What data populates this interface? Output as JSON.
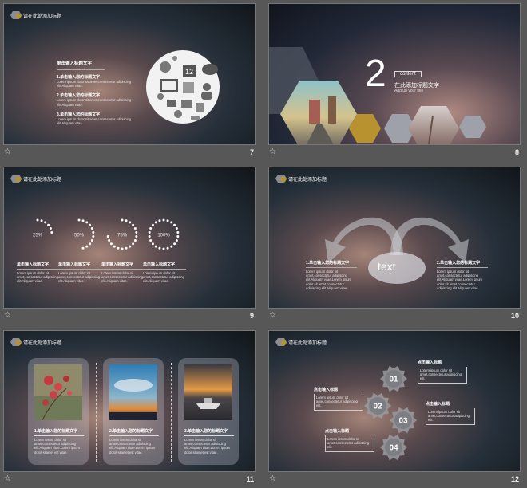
{
  "slides": {
    "s7": {
      "number": "7",
      "header": "请在此处添加标题",
      "title": "单击输入标题文字",
      "items": [
        {
          "heading": "1.单击输入您的标题文字",
          "body": "Lorem ipsum dolor sit amet,consectetur adipiscing elit.Aliquam vitae."
        },
        {
          "heading": "2.单击输入您的标题文字",
          "body": "Lorem ipsum dolor sit amet,consectetur adipiscing elit.Aliquam vitae."
        },
        {
          "heading": "3.单击输入您的标题文字",
          "body": "Lorem ipsum dolor sit amet,consectetur adipiscing elit.Aliquam vitae."
        }
      ],
      "icon_cluster_label": "12"
    },
    "s8": {
      "number": "8",
      "big_number": "2",
      "badge": "content",
      "title": "在此添加标题文字",
      "subtitle": "Add up your title"
    },
    "s9": {
      "number": "9",
      "header": "请在此处添加标题",
      "progress": [
        {
          "label": "25%",
          "value": 0.25,
          "heading": "单击输入标题文字",
          "body": "Lorem ipsum dolor sit amet,consectetur adipiscing elit.Aliquam vitae."
        },
        {
          "label": "50%",
          "value": 0.5,
          "heading": "单击输入标题文字",
          "body": "Lorem ipsum dolor sit amet,consectetur adipiscing elit.Aliquam vitae."
        },
        {
          "label": "75%",
          "value": 0.75,
          "heading": "单击输入标题文字",
          "body": "Lorem ipsum dolor sit amet,consectetur adipiscing elit.Aliquam vitae."
        },
        {
          "label": "100%",
          "value": 1.0,
          "heading": "单击输入标题文字",
          "body": "Lorem ipsum dolor sit amet,consectetur adipiscing elit.Aliquam vitae."
        }
      ]
    },
    "s10": {
      "number": "10",
      "header": "请在此处添加标题",
      "center_text": "text",
      "left": {
        "heading": "1.单击输入您的标题文字",
        "body": "Lorem ipsum dolor sit amet,consectetur adipiscing elit.Aliquam vitae.Lorem ipsum dolor sit amet,consectetur adipiscing elit.Aliquam vitae."
      },
      "right": {
        "heading": "2.单击输入您的标题文字",
        "body": "Lorem ipsum dolor sit amet,consectetur adipiscing elit.Aliquam vitae.Lorem ipsum dolor sit amet,consectetur adipiscing elit.Aliquam vitae."
      }
    },
    "s11": {
      "number": "11",
      "header": "请在此处添加标题",
      "cards": [
        {
          "heading": "1.单击输入您的标题文字",
          "body": "Lorem ipsum dolor sit amet,consectetur adipiscing elit.Aliquam vitae.Lorem ipsum dolor sitamet elit vitae."
        },
        {
          "heading": "2.单击输入您的标题文字",
          "body": "Lorem ipsum dolor sit amet,consectetur adipiscing elit.Aliquam vitae.Lorem ipsum dolor sitamet elit vitae."
        },
        {
          "heading": "3.单击输入您的标题文字",
          "body": "Lorem ipsum dolor sit amet,consectetur adipiscing elit.Aliquam vitae.Lorem ipsum dolor sitamet elit vitae."
        }
      ]
    },
    "s12": {
      "number": "12",
      "header": "请在此处添加标题",
      "gears": [
        "01",
        "02",
        "03",
        "04"
      ],
      "notes": [
        {
          "heading": "点击输入标题",
          "body": "Lorem ipsum dolor sit amet,consectetur adipiscing elit."
        },
        {
          "heading": "点击输入标题",
          "body": "Lorem ipsum dolor sit amet,consectetur adipiscing elit."
        },
        {
          "heading": "点击输入标题",
          "body": "Lorem ipsum dolor sit amet,consectetur adipiscing elit."
        },
        {
          "heading": "点击输入标题",
          "body": "Lorem ipsum dolor sit amet,consectetur adipiscing elit."
        }
      ]
    }
  },
  "icons": {
    "star": "☆"
  },
  "colors": {
    "accent_gold": "#b7922e",
    "hex_gray": "#8c8c96",
    "background": "#575757"
  }
}
